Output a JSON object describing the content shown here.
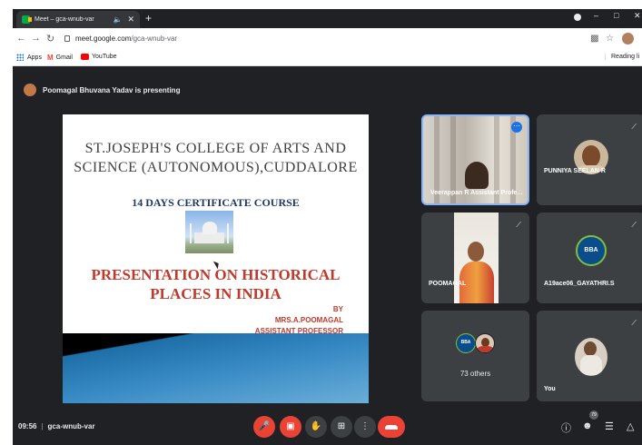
{
  "browser": {
    "tab_title": "Meet – gca-wnub-var",
    "tab_audio_icon": "speaker-icon",
    "url_host": "meet.google.com",
    "url_path": "/gca-wnub-var",
    "bookmarks": [
      {
        "label": "Apps"
      },
      {
        "label": "Gmail"
      },
      {
        "label": "YouTube"
      }
    ],
    "reading_list_label": "Reading li"
  },
  "meet": {
    "presenting_text": "Poomagal Bhuvana Yadav is presenting",
    "slide": {
      "college_line1": "ST.JOSEPH'S COLLEGE OF ARTS AND",
      "college_line2": "SCIENCE (AUTONOMOUS),CUDDALORE",
      "course": "14 DAYS CERTIFICATE COURSE",
      "title_line1": "PRESENTATION ON HISTORICAL",
      "title_line2": "PLACES IN INDIA",
      "by": "BY",
      "author": "MRS.A.POOMAGAL",
      "role": "ASSISTANT PROFESSOR"
    },
    "participants": [
      {
        "name": "Veerappan R Assistant Profe..."
      },
      {
        "name": "PUNNIYA SEELAN R"
      },
      {
        "name": "POOMAGAL"
      },
      {
        "name": "A19ace06_GAYATHRI.S",
        "logo_text": "BBA"
      },
      {
        "name": "",
        "others_label": "73 others",
        "logo_text": "BBA"
      },
      {
        "name": "You"
      }
    ],
    "meeting_time": "09:56",
    "meeting_code": "gca-wnub-var",
    "people_count": "79"
  },
  "colors": {
    "meet_bg": "#202124",
    "tile_bg": "#3c4043",
    "danger": "#ea4335",
    "slide_title": "#c0392b"
  }
}
